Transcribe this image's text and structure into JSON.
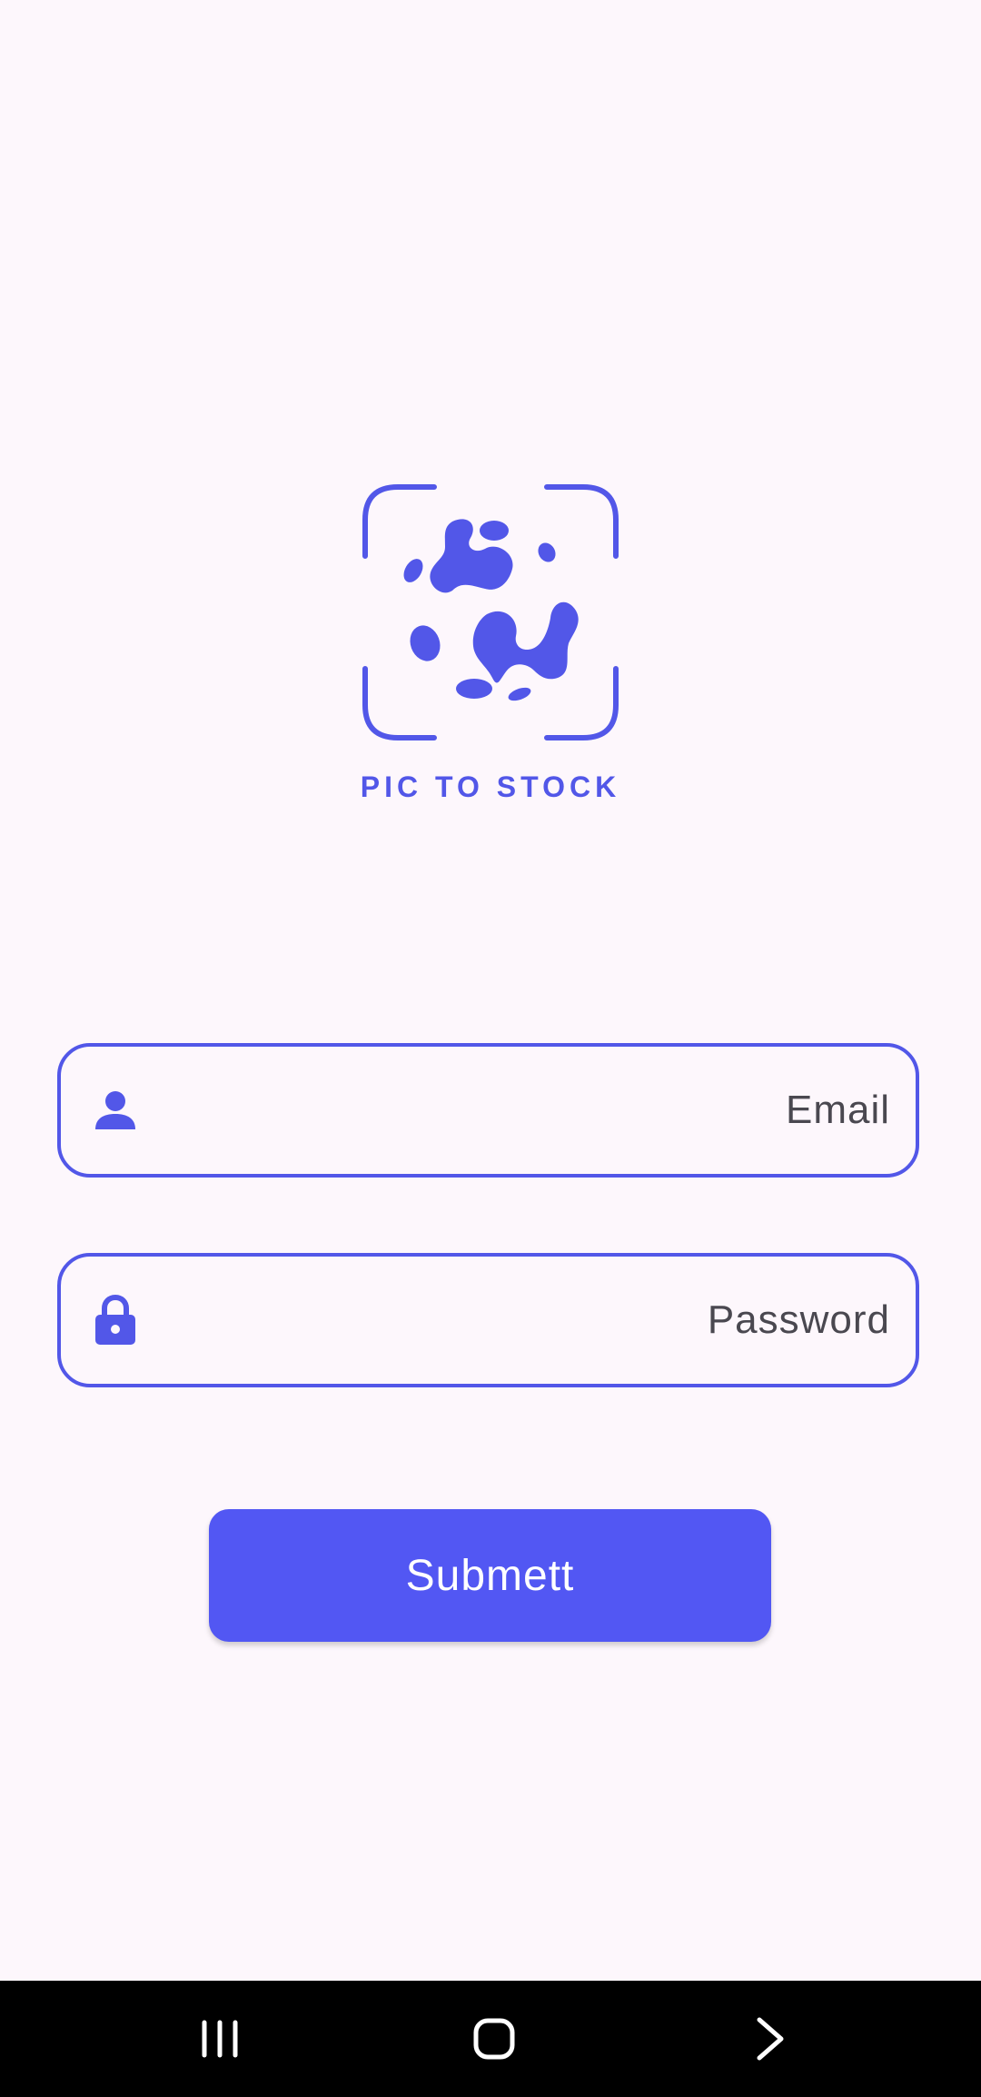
{
  "brand": {
    "name": "PIC TO STOCK",
    "color": "#5257e8",
    "logo_icon": "camera-frame-blob-logo"
  },
  "form": {
    "email": {
      "placeholder": "Email",
      "value": "",
      "icon": "person-icon"
    },
    "password": {
      "placeholder": "Password",
      "value": "",
      "icon": "lock-icon"
    },
    "submit_label": "Submett"
  },
  "navigation_bar": {
    "buttons": [
      "recents",
      "home",
      "back"
    ]
  },
  "colors": {
    "background": "#fdf7fc",
    "accent": "#5257f3",
    "nav_bar": "#000000"
  }
}
